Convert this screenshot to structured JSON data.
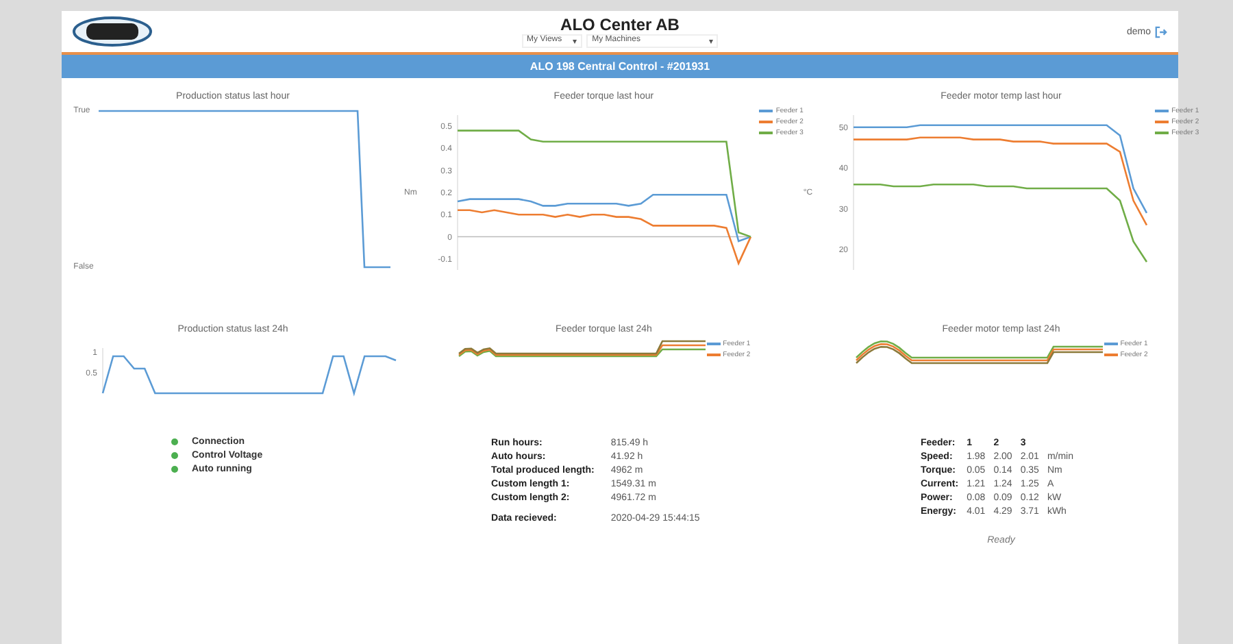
{
  "header": {
    "title": "ALO Center AB",
    "views_select": "My Views",
    "machines_select": "My Machines",
    "caret": "▾",
    "user": "demo"
  },
  "machine_bar": {
    "title": "ALO 198 Central Control - #201931"
  },
  "charts_hour": [
    {
      "title": "Production status last hour",
      "kind": "status",
      "ytick_labels": [
        "True",
        "False"
      ]
    },
    {
      "title": "Feeder torque last hour",
      "kind": "chart",
      "chart_data": {
        "type": "line",
        "ylabel": "Nm",
        "ylim": [
          -0.15,
          0.55
        ],
        "yticks": [
          0.5,
          0.4,
          0.3,
          0.2,
          0.1,
          0,
          -0.1
        ],
        "series": [
          {
            "name": "Feeder 1",
            "color": "#5b9bd5",
            "values": [
              0.16,
              0.17,
              0.17,
              0.17,
              0.17,
              0.17,
              0.16,
              0.14,
              0.14,
              0.15,
              0.15,
              0.15,
              0.15,
              0.15,
              0.14,
              0.15,
              0.19,
              0.19,
              0.19,
              0.19,
              0.19,
              0.19,
              0.19,
              -0.02,
              0
            ]
          },
          {
            "name": "Feeder 2",
            "color": "#ed7d31",
            "values": [
              0.12,
              0.12,
              0.11,
              0.12,
              0.11,
              0.1,
              0.1,
              0.1,
              0.09,
              0.1,
              0.09,
              0.1,
              0.1,
              0.09,
              0.09,
              0.08,
              0.05,
              0.05,
              0.05,
              0.05,
              0.05,
              0.05,
              0.04,
              -0.12,
              0
            ]
          },
          {
            "name": "Feeder 3",
            "color": "#70ad47",
            "values": [
              0.48,
              0.48,
              0.48,
              0.48,
              0.48,
              0.48,
              0.44,
              0.43,
              0.43,
              0.43,
              0.43,
              0.43,
              0.43,
              0.43,
              0.43,
              0.43,
              0.43,
              0.43,
              0.43,
              0.43,
              0.43,
              0.43,
              0.43,
              0.02,
              0
            ]
          }
        ]
      }
    },
    {
      "title": "Feeder motor temp last hour",
      "kind": "chart",
      "chart_data": {
        "type": "line",
        "ylabel": "°C",
        "ylim": [
          15,
          53
        ],
        "yticks": [
          50,
          40,
          30,
          20
        ],
        "series": [
          {
            "name": "Feeder 1",
            "color": "#5b9bd5",
            "values": [
              50,
              50,
              50,
              50,
              50,
              50.5,
              50.5,
              50.5,
              50.5,
              50.5,
              50.5,
              50.5,
              50.5,
              50.5,
              50.5,
              50.5,
              50.5,
              50.5,
              50.5,
              50.5,
              48,
              35,
              29
            ]
          },
          {
            "name": "Feeder 2",
            "color": "#ed7d31",
            "values": [
              47,
              47,
              47,
              47,
              47,
              47.5,
              47.5,
              47.5,
              47.5,
              47,
              47,
              47,
              46.5,
              46.5,
              46.5,
              46,
              46,
              46,
              46,
              46,
              44,
              32,
              26
            ]
          },
          {
            "name": "Feeder 3",
            "color": "#70ad47",
            "values": [
              36,
              36,
              36,
              35.5,
              35.5,
              35.5,
              36,
              36,
              36,
              36,
              35.5,
              35.5,
              35.5,
              35,
              35,
              35,
              35,
              35,
              35,
              35,
              32,
              22,
              17
            ]
          }
        ]
      }
    }
  ],
  "charts_day": [
    {
      "title": "Production status last 24h",
      "kind": "chart",
      "chart_data": {
        "type": "line",
        "ylim": [
          0,
          1.1
        ],
        "yticks": [
          {
            "value": 1,
            "label": "1"
          },
          {
            "value": 0.5,
            "label": "0.5"
          }
        ],
        "series": [
          {
            "color": "#5b9bd5",
            "values": [
              0,
              0.9,
              0.9,
              0.6,
              0.6,
              0,
              0,
              0,
              0,
              0,
              0,
              0,
              0,
              0,
              0,
              0,
              0,
              0,
              0,
              0,
              0,
              0,
              0.9,
              0.9,
              0,
              0.9,
              0.9,
              0.9,
              0.8
            ]
          }
        ]
      }
    },
    {
      "title": "Feeder torque last 24h",
      "kind": "torque",
      "legend": [
        "Feeder 1",
        "Feeder 2"
      ]
    },
    {
      "title": "Feeder motor temp last 24h",
      "kind": "temp",
      "legend": [
        "Feeder 1",
        "Feeder 2"
      ]
    }
  ],
  "status_lights": [
    {
      "label": "Connection",
      "color": "#4caf50"
    },
    {
      "label": "Control Voltage",
      "color": "#4caf50"
    },
    {
      "label": "Auto running",
      "color": "#4caf50"
    }
  ],
  "counters": [
    {
      "label": "Run hours:",
      "value": "815.49 h"
    },
    {
      "label": "Auto hours:",
      "value": "41.92 h"
    },
    {
      "label": "Total produced length:",
      "value": "4962 m"
    },
    {
      "label": "Custom length 1:",
      "value": "1549.31 m"
    },
    {
      "label": "Custom length 2:",
      "value": "4961.72 m"
    },
    {
      "label": "Data recieved:",
      "value": "2020-04-29 15:44:15"
    }
  ],
  "feeders": {
    "header": [
      "Feeder:",
      "1",
      "2",
      "3"
    ],
    "rows": [
      [
        "Speed:",
        "1.98",
        "2.00",
        "2.01",
        "m/min"
      ],
      [
        "Torque:",
        "0.05",
        "0.14",
        "0.35",
        "Nm"
      ],
      [
        "Current:",
        "1.21",
        "1.24",
        "1.25",
        "A"
      ],
      [
        "Power:",
        "0.08",
        "0.09",
        "0.12",
        "kW"
      ],
      [
        "Energy:",
        "4.01",
        "4.29",
        "3.71",
        "kWh"
      ]
    ]
  },
  "status_text": "Ready"
}
